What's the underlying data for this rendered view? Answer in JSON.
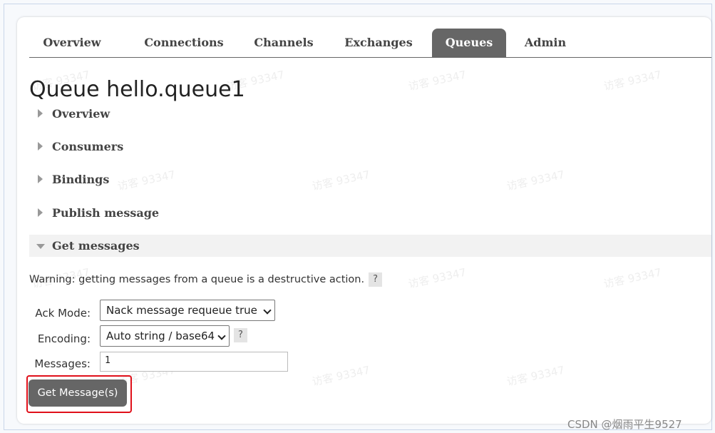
{
  "tabs": [
    {
      "label": "Overview",
      "active": false
    },
    {
      "label": "Connections",
      "active": false
    },
    {
      "label": "Channels",
      "active": false
    },
    {
      "label": "Exchanges",
      "active": false
    },
    {
      "label": "Queues",
      "active": true
    },
    {
      "label": "Admin",
      "active": false
    }
  ],
  "title": {
    "prefix": "Queue",
    "queue_name": "hello.queue1"
  },
  "sections": [
    {
      "label": "Overview",
      "expanded": false
    },
    {
      "label": "Consumers",
      "expanded": false
    },
    {
      "label": "Bindings",
      "expanded": false
    },
    {
      "label": "Publish message",
      "expanded": false
    },
    {
      "label": "Get messages",
      "expanded": true
    }
  ],
  "get_messages": {
    "warning": "Warning: getting messages from a queue is a destructive action.",
    "help_glyph": "?",
    "ack_mode_label": "Ack Mode:",
    "ack_mode_value": "Nack message requeue true",
    "encoding_label": "Encoding:",
    "encoding_value": "Auto string / base64",
    "messages_label": "Messages:",
    "messages_value": "1",
    "button_label": "Get Message(s)"
  },
  "watermark_text": "访客 93347",
  "attribution": "CSDN @烟雨平生9527",
  "colors": {
    "active_tab_bg": "#666666",
    "button_bg": "#666666",
    "highlight_border": "#e0101a",
    "open_section_bg": "#f2f2f2"
  },
  "icons": {
    "collapsed": "triangle-right-icon",
    "expanded": "triangle-down-icon",
    "select": "chevron-down-icon"
  }
}
